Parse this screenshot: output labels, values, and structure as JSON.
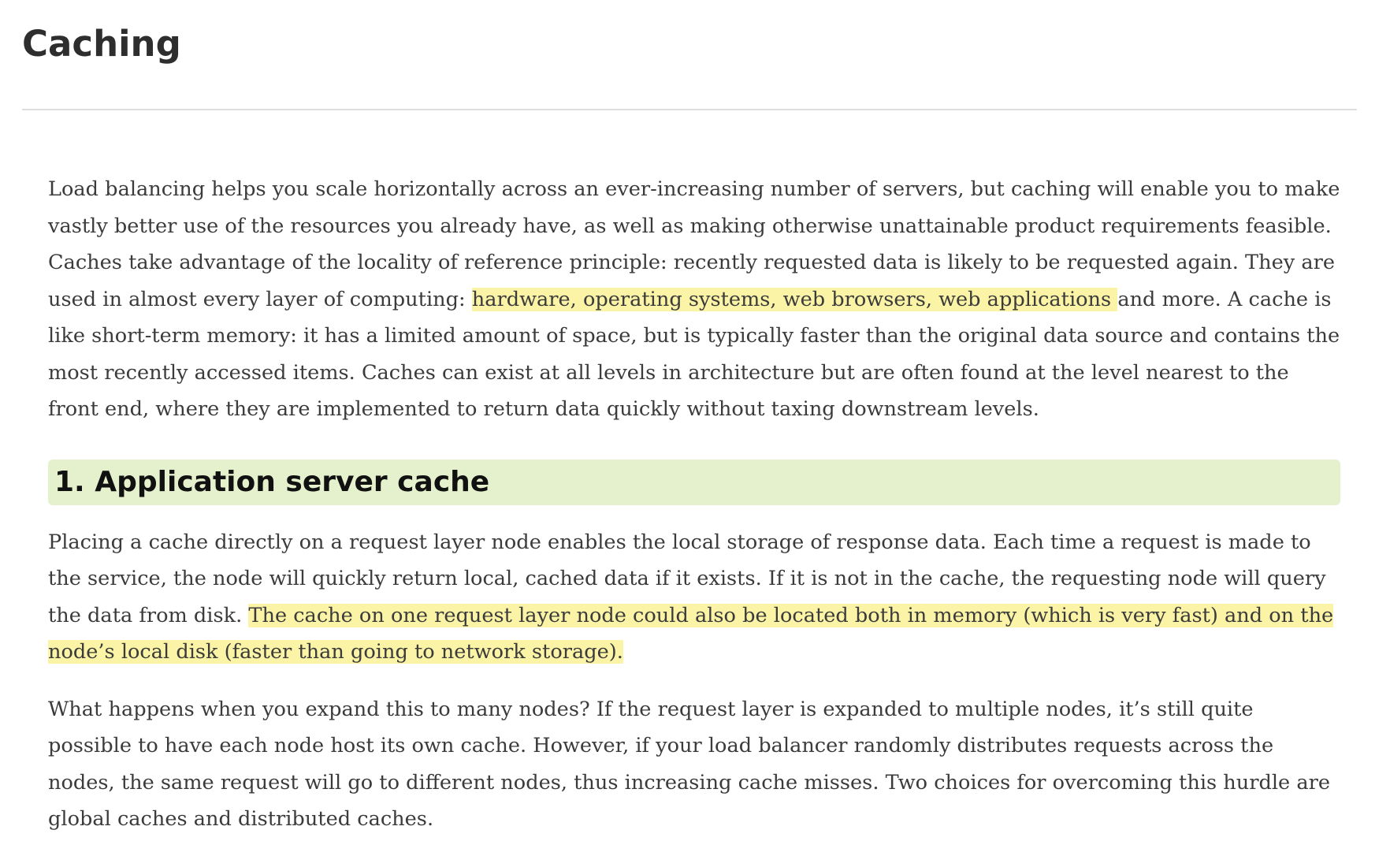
{
  "page": {
    "title": "Caching"
  },
  "intro": {
    "before": "Load balancing helps you scale horizontally across an ever-increasing number of servers, but caching will enable you to make vastly better use of the resources you already have, as well as making otherwise unattainable product requirements feasible. Caches take advantage of the locality of reference principle: recently requested data is likely to be requested again. They are used in almost every layer of computing: ",
    "highlight": "hardware, operating systems, web browsers, web applications ",
    "after": "and more. A cache is like short-term memory: it has a limited amount of space, but is typically faster than the original data source and contains the most recently accessed items. Caches can exist at all levels in architecture but are often found at the level nearest to the front end, where they are implemented to return data quickly without taxing downstream levels."
  },
  "section1": {
    "heading": "1. Application server cache",
    "para1": {
      "before": "Placing a cache directly on a request layer node enables the local storage of response data. Each time a request is made to the service, the node will quickly return local, cached data if it exists. If it is not in the cache, the requesting node will query the data from disk. ",
      "highlight": "The cache on one request layer node could also be located both in memory (which is very fast) and on the node’s local disk (faster than going to network storage)."
    },
    "para2": "What happens when you expand this to many nodes? If the request layer is expanded to multiple nodes, it’s still quite possible to have each node host its own cache. However, if your load balancer randomly distributes requests across the nodes, the same request will go to different nodes, thus increasing cache misses. Two choices for overcoming this hurdle are global caches and distributed caches."
  },
  "colors": {
    "highlight": "#fbf4a6",
    "heading_background": "#e4f1cc",
    "rule": "#dddddd",
    "text": "#3b3b3b"
  }
}
